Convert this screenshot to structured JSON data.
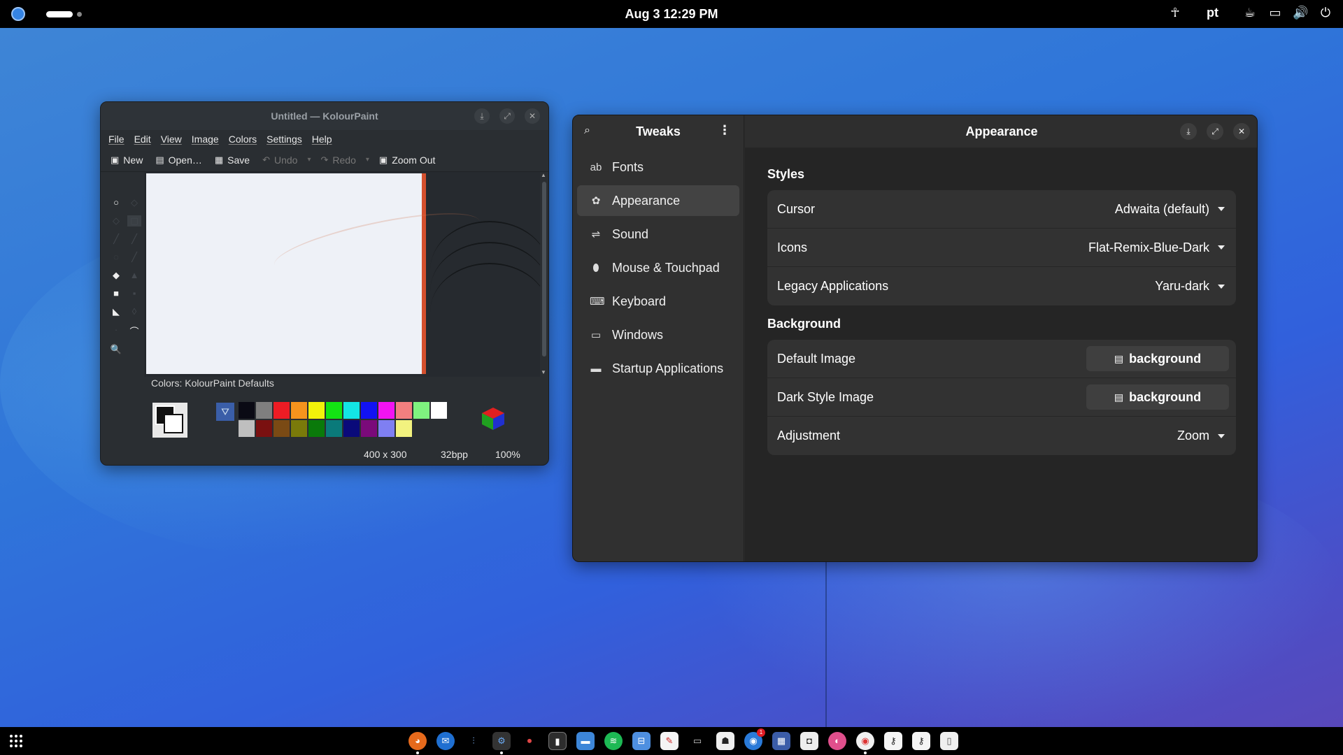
{
  "topbar": {
    "clock": "Aug 3  12:29 PM",
    "keyboard_layout": "pt",
    "icons": [
      "accessibility-icon",
      "caffeine-icon",
      "screen-icon",
      "volume-icon",
      "power-icon"
    ]
  },
  "kolourpaint": {
    "title": "Untitled — KolourPaint",
    "menu": [
      "File",
      "Edit",
      "View",
      "Image",
      "Colors",
      "Settings",
      "Help"
    ],
    "toolbar": {
      "new": "New",
      "open": "Open…",
      "save": "Save",
      "undo": "Undo",
      "redo": "Redo",
      "zoom_out": "Zoom Out"
    },
    "colors_label": "Colors: KolourPaint Defaults",
    "palette": [
      "#0a0a14",
      "#7f7f7f",
      "#ed1c24",
      "#f7941d",
      "#f2f20a",
      "#13e313",
      "#13e5e5",
      "#1212f2",
      "#f213f2",
      "#f27f7f",
      "#7ff27f",
      "#ffffff",
      "#bfbfbf",
      "#7a1010",
      "#7a4a14",
      "#7a7a0a",
      "#0a7a0a",
      "#0a7a7a",
      "#0a0a7a",
      "#7a0a7a",
      "#7f7ff2",
      "#f2f27f"
    ],
    "status": {
      "dimensions": "400 x 300",
      "depth": "32bpp",
      "zoom": "100%"
    }
  },
  "tweaks": {
    "sidebar_title": "Tweaks",
    "sidebar_items": [
      {
        "label": "Fonts",
        "icon": "font-icon"
      },
      {
        "label": "Appearance",
        "icon": "appearance-icon",
        "selected": true
      },
      {
        "label": "Sound",
        "icon": "sound-icon"
      },
      {
        "label": "Mouse & Touchpad",
        "icon": "mouse-icon"
      },
      {
        "label": "Keyboard",
        "icon": "keyboard-icon"
      },
      {
        "label": "Windows",
        "icon": "window-icon"
      },
      {
        "label": "Startup Applications",
        "icon": "folder-icon"
      }
    ],
    "page_title": "Appearance",
    "styles_heading": "Styles",
    "styles": {
      "cursor_label": "Cursor",
      "cursor_value": "Adwaita (default)",
      "icons_label": "Icons",
      "icons_value": "Flat-Remix-Blue-Dark",
      "legacy_label": "Legacy Applications",
      "legacy_value": "Yaru-dark"
    },
    "background_heading": "Background",
    "background": {
      "default_label": "Default Image",
      "default_value": "background",
      "dark_label": "Dark Style Image",
      "dark_value": "background",
      "adjust_label": "Adjustment",
      "adjust_value": "Zoom"
    }
  },
  "dock": {
    "apps": [
      "firefox-icon",
      "thunderbird-icon",
      "tweaks-tools-icon",
      "settings-icon",
      "toggle-icon",
      "terminal-icon",
      "files-icon",
      "spotify-icon",
      "software-icon",
      "text-editor-icon",
      "game-controller-icon",
      "inkscape-icon",
      "chrome-icon",
      "monitor-icon",
      "screenshot-icon",
      "kolourpaint-icon",
      "chrome-icon",
      "secrets-icon",
      "secrets-icon",
      "trash-icon"
    ]
  }
}
